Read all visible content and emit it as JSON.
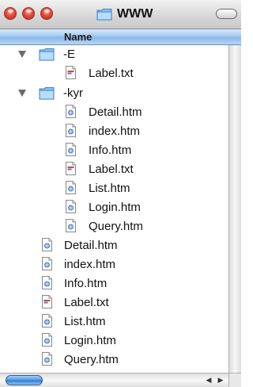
{
  "window": {
    "title": "WWW"
  },
  "header": {
    "name_label": "Name"
  },
  "rows": [
    {
      "label": "-E",
      "kind": "folder",
      "expanded": true
    },
    {
      "label": "Label.txt",
      "kind": "txt"
    },
    {
      "label": "-kyr",
      "kind": "folder",
      "expanded": true
    },
    {
      "label": "Detail.htm",
      "kind": "htm"
    },
    {
      "label": "index.htm",
      "kind": "htm"
    },
    {
      "label": "Info.htm",
      "kind": "htm"
    },
    {
      "label": "Label.txt",
      "kind": "txt"
    },
    {
      "label": "List.htm",
      "kind": "htm"
    },
    {
      "label": "Login.htm",
      "kind": "htm"
    },
    {
      "label": "Query.htm",
      "kind": "htm"
    },
    {
      "label": "Detail.htm",
      "kind": "htm"
    },
    {
      "label": "index.htm",
      "kind": "htm"
    },
    {
      "label": "Info.htm",
      "kind": "htm"
    },
    {
      "label": "Label.txt",
      "kind": "txt"
    },
    {
      "label": "List.htm",
      "kind": "htm"
    },
    {
      "label": "Login.htm",
      "kind": "htm"
    },
    {
      "label": "Query.htm",
      "kind": "htm"
    }
  ],
  "colors": {
    "header": "#9fc6ef",
    "scroll_thumb": "#4f95e0",
    "close_button": "#e8493a"
  },
  "icons": {
    "folder": "folder-icon",
    "htm": "html-document-icon",
    "txt": "text-document-icon",
    "disclosure": "disclosure-triangle-icon"
  }
}
